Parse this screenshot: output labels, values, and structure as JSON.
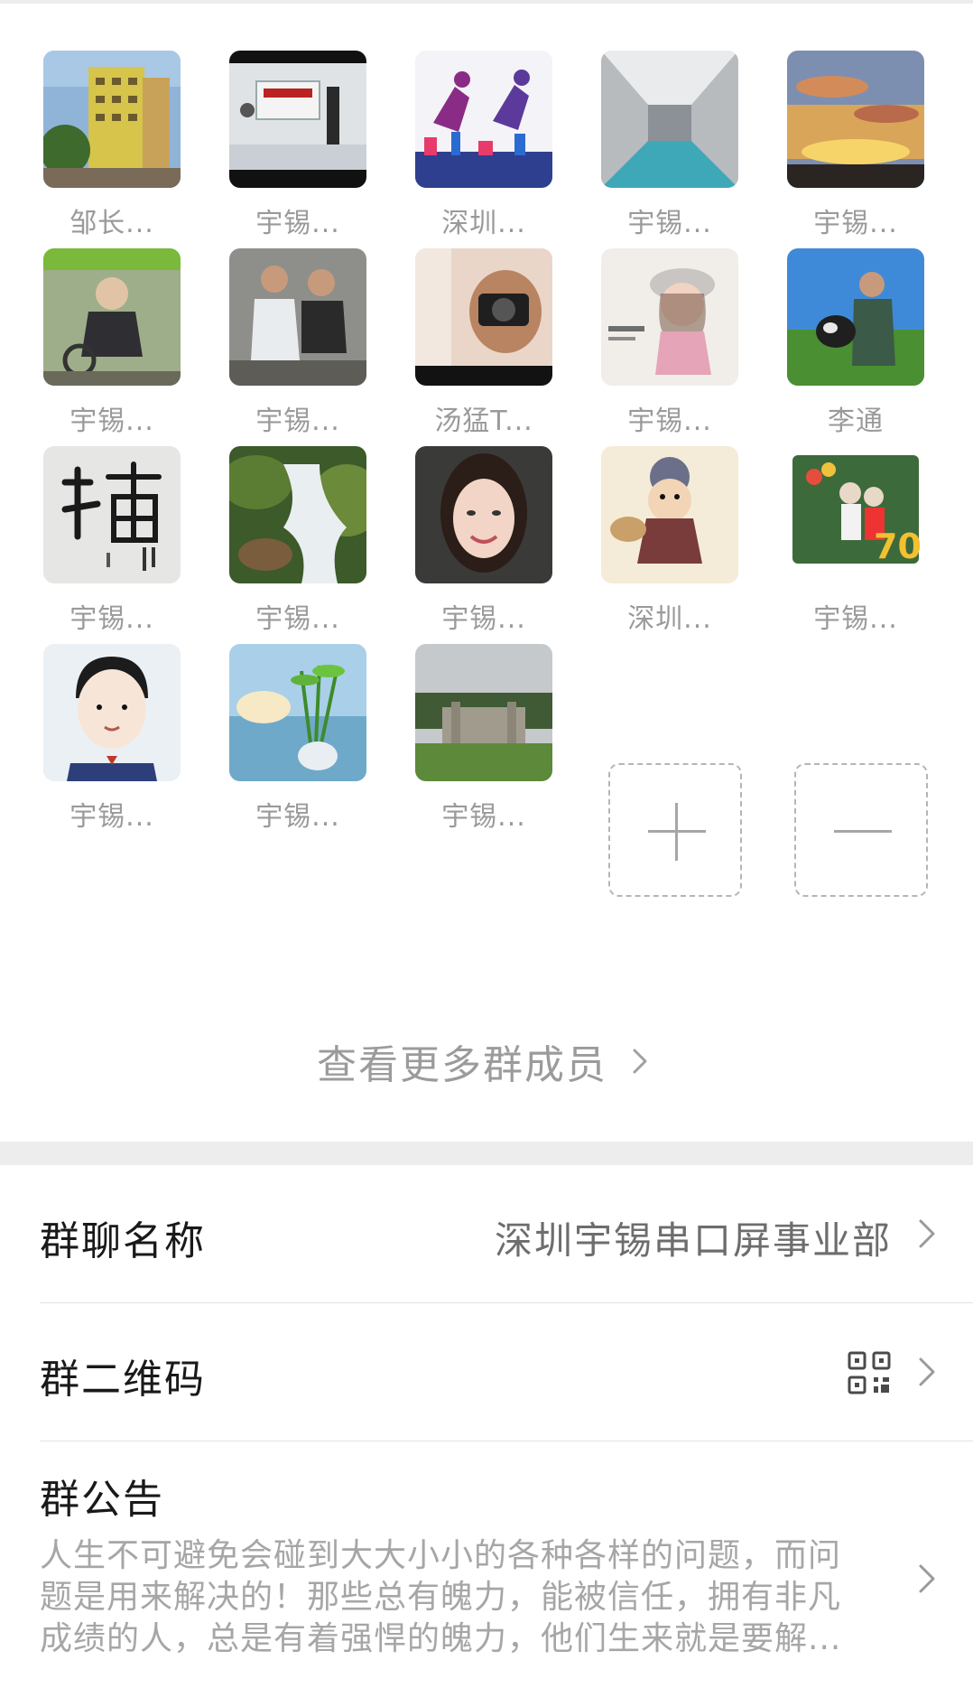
{
  "members": [
    {
      "name": "邹长...",
      "avatar": "building-photo-icon"
    },
    {
      "name": "宇锡...",
      "avatar": "office-lobby-photo-icon"
    },
    {
      "name": "深圳...",
      "avatar": "runners-illustration-icon"
    },
    {
      "name": "宇锡...",
      "avatar": "corridor-photo-icon"
    },
    {
      "name": "宇锡...",
      "avatar": "sunset-sky-photo-icon"
    },
    {
      "name": "宇锡...",
      "avatar": "man-on-bike-photo-icon"
    },
    {
      "name": "宇锡...",
      "avatar": "two-friends-photo-icon"
    },
    {
      "name": "汤猛T...",
      "avatar": "camera-selfie-photo-icon"
    },
    {
      "name": "宇锡...",
      "avatar": "cartoon-girl-icon"
    },
    {
      "name": "李通",
      "avatar": "man-with-dog-photo-icon"
    },
    {
      "name": "宇锡...",
      "avatar": "calligraphy-icon"
    },
    {
      "name": "宇锡...",
      "avatar": "waterfall-photo-icon"
    },
    {
      "name": "宇锡...",
      "avatar": "woman-portrait-photo-icon"
    },
    {
      "name": "深圳...",
      "avatar": "cartoon-boy-icon"
    },
    {
      "name": "宇锡...",
      "avatar": "kids-balloons-70-icon"
    },
    {
      "name": "宇锡...",
      "avatar": "cartoon-man-icon"
    },
    {
      "name": "宇锡...",
      "avatar": "bamboo-plant-icon"
    },
    {
      "name": "宇锡...",
      "avatar": "campus-gate-photo-icon"
    }
  ],
  "more_members_label": "查看更多群成员",
  "settings": {
    "group_name_label": "群聊名称",
    "group_name_value": "深圳宇锡串口屏事业部",
    "qr_code_label": "群二维码",
    "notice_label": "群公告",
    "notice_text": "人生不可避免会碰到大大小小的各种各样的问题，而问题是用来解决的！那些总有魄力，能被信任，拥有非凡成绩的人，总是有着强悍的魄力，他们生来就是要解..."
  },
  "colors": {
    "background": "#ededed",
    "panel": "#ffffff",
    "primary_text": "#191919",
    "secondary_text": "#9a9a9a"
  }
}
